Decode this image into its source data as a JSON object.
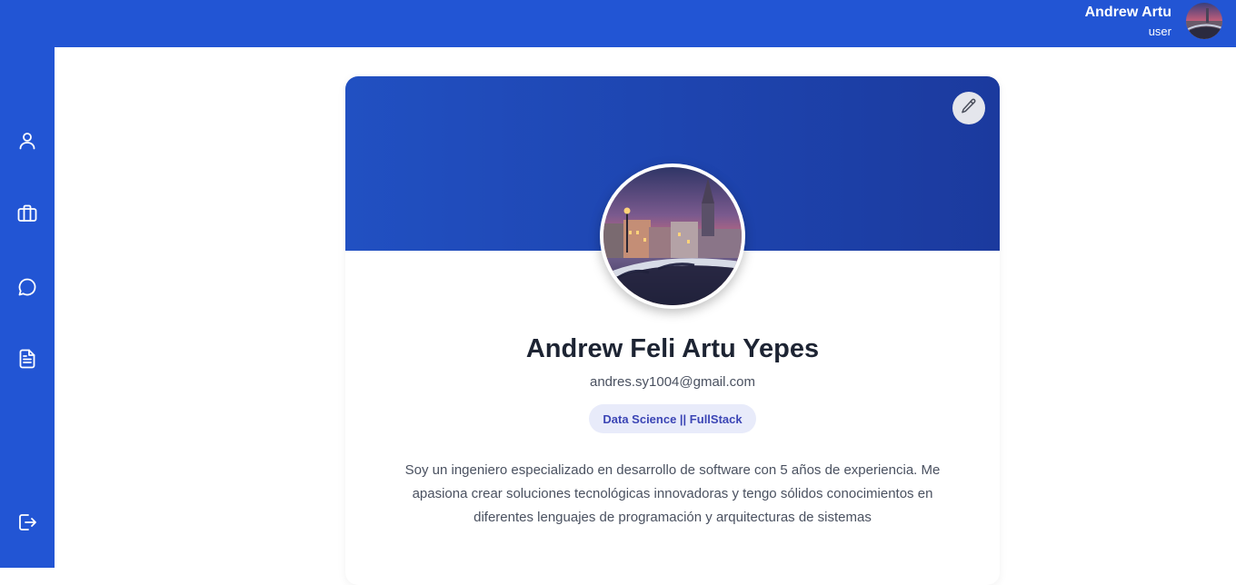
{
  "header": {
    "user_name": "Andrew Artu",
    "user_role": "user"
  },
  "sidebar": {
    "items": [
      {
        "icon": "user-icon"
      },
      {
        "icon": "briefcase-icon"
      },
      {
        "icon": "chat-icon"
      },
      {
        "icon": "document-icon"
      },
      {
        "icon": "logout-icon"
      }
    ]
  },
  "profile": {
    "full_name": "Andrew Feli Artu Yepes",
    "email": "andres.sy1004@gmail.com",
    "tag": "Data Science || FullStack",
    "bio": "Soy un ingeniero especializado en desarrollo de software con 5 años de experiencia. Me apasiona crear soluciones tecnológicas innovadoras y tengo sólidos conocimientos en diferentes lenguajes de programación y arquitecturas de sistemas"
  },
  "colors": {
    "primary": "#2255d4",
    "banner_start": "#2150c2",
    "banner_end": "#1b3a9e",
    "tag_bg": "#e8ebfa",
    "tag_text": "#3b45b5"
  }
}
